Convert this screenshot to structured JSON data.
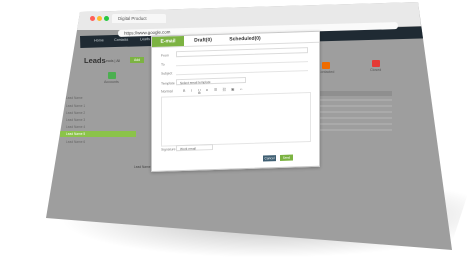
{
  "browser": {
    "tab_title": "Digital Product",
    "url": "https://www.google.com",
    "dot_colors": [
      "#ff5f57",
      "#febc2e",
      "#28c840"
    ]
  },
  "app": {
    "nav_items": [
      "Home",
      "Contacts",
      "Leads",
      "Deals",
      "Accounts"
    ],
    "page_title": "Leads",
    "subtitle": "Leads | All",
    "add_button": "Add",
    "kpis": [
      {
        "label": "Accounts",
        "color": "#4caf50"
      },
      {
        "label": "Contacted",
        "color": "#ef6c00"
      },
      {
        "label": "Closed",
        "color": "#e53935"
      }
    ],
    "sidebar": {
      "items": [
        "Lead Name",
        "Lead Name 1",
        "Lead Name 2",
        "Lead Name 3",
        "Lead Name 4",
        "Lead Name 5",
        "Lead Name 6"
      ],
      "active_index": 5
    },
    "bottom_text": "Lead Name John Doe"
  },
  "modal": {
    "tabs": [
      {
        "label": "E-mail",
        "active": true
      },
      {
        "label": "Draft(0)",
        "active": false
      },
      {
        "label": "Scheduled(0)",
        "active": false
      }
    ],
    "fields": {
      "from_label": "From",
      "from_value": "",
      "to_label": "To",
      "subject_label": "Subject",
      "template_label": "Template",
      "template_value": "Select email template"
    },
    "toolbar_font": "Normal",
    "signature_label": "Signature",
    "signature_value": "Work email",
    "cancel_label": "Cancel",
    "send_label": "Send"
  },
  "colors": {
    "accent_green": "#7cb342",
    "dark_blue": "#3f5f73",
    "appbar": "#1f2a33"
  }
}
